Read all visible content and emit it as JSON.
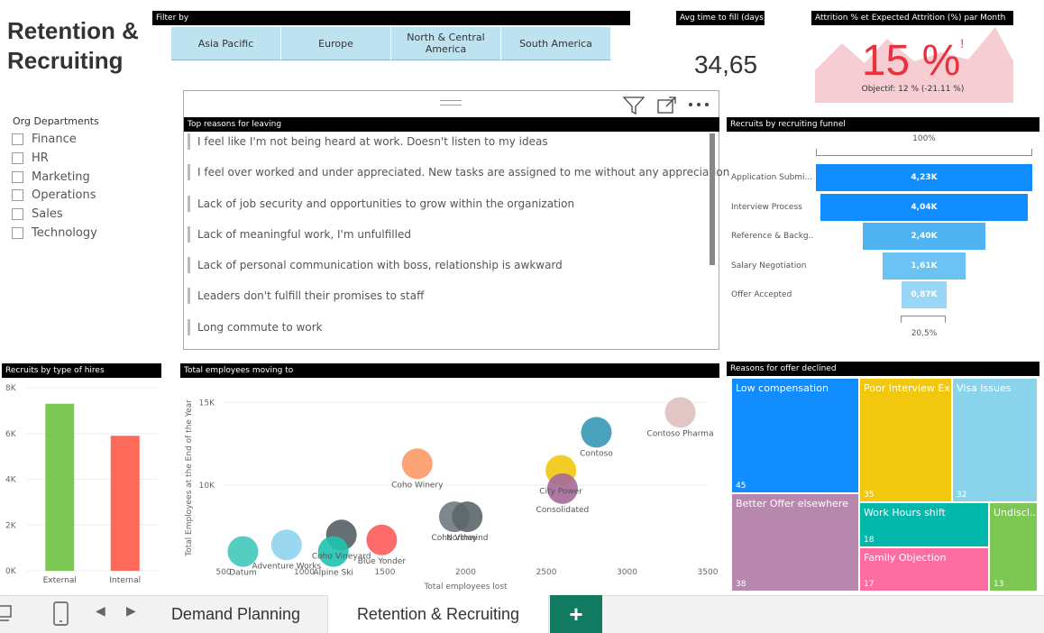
{
  "report": {
    "title": "Retention & Recruiting"
  },
  "filter": {
    "header": "Filter by",
    "options": [
      "Asia Pacific",
      "Europe",
      "North & Central America",
      "South America"
    ]
  },
  "avg_time": {
    "header": "Avg time to fill (days)",
    "value": "34,65"
  },
  "attrition": {
    "header": "Attrition % et Expected Attrition (%) par Month",
    "value": "15 %",
    "marker": "!",
    "target": "Objectif: 12 % (-21.11 %)",
    "colors": {
      "value": "#e8323d",
      "area": "#f6cdd3"
    }
  },
  "org": {
    "title": "Org Departments",
    "items": [
      "Finance",
      "HR",
      "Marketing",
      "Operations",
      "Sales",
      "Technology"
    ]
  },
  "reasons": {
    "header": "Top reasons for leaving",
    "items": [
      "I feel like I'm not being heard at work. Doesn't listen to my ideas",
      "I feel over worked and under appreciated. New tasks are assigned to me without any appreciation",
      "Lack of job security and opportunities to grow within the organization",
      "Lack of meaningful work, I'm unfulfilled",
      "Lack of personal communication with boss, relationship is awkward",
      "Leaders don't fulfill their promises to staff",
      "Long commute to work"
    ]
  },
  "toolbar": {
    "filter_icon": "filter-icon",
    "focus_icon": "focus-mode-icon",
    "more_icon": "more-options-icon"
  },
  "chart_data": [
    {
      "type": "bar",
      "orientation": "horizontal-funnel",
      "title": "Recruits by recruiting funnel",
      "categories": [
        "Application Submi...",
        "Interview Process",
        "Reference & Backg...",
        "Salary Negotiation",
        "Offer Accepted"
      ],
      "values": [
        4230,
        4040,
        2400,
        1610,
        870
      ],
      "value_labels": [
        "4,23K",
        "4,04K",
        "2,40K",
        "1,61K",
        "0,87K"
      ],
      "top_percent": "100%",
      "bottom_percent": "20,5%",
      "colors": [
        "#118dff",
        "#118dff",
        "#4fb3f2",
        "#6cc2f2",
        "#9ad6f5"
      ]
    },
    {
      "type": "bar",
      "title": "Recruits by type of hires",
      "categories": [
        "External",
        "Internal"
      ],
      "values": [
        7300,
        5900
      ],
      "ylim": [
        0,
        8000
      ],
      "yticks": [
        "0K",
        "2K",
        "4K",
        "6K",
        "8K"
      ],
      "colors": [
        "#7dc855",
        "#fd6a5a"
      ]
    },
    {
      "type": "scatter",
      "title": "Total employees moving to",
      "xlabel": "Total employees lost",
      "ylabel": "Total Employees at the End of the Year",
      "xlim": [
        500,
        3500
      ],
      "ylim": [
        5000,
        16000
      ],
      "xticks": [
        "500",
        "1000",
        "1500",
        "2000",
        "2500",
        "3000",
        "3500"
      ],
      "yticks": [
        "10K",
        "15K"
      ],
      "points": [
        {
          "label": "Datum",
          "x": 620,
          "y": 6000,
          "color": "#41c8bd"
        },
        {
          "label": "Adventure Works",
          "x": 890,
          "y": 6400,
          "color": "#8fd3ef"
        },
        {
          "label": "Coho Vineyard",
          "x": 1230,
          "y": 7000,
          "color": "#555f64"
        },
        {
          "label": "Alpine Ski",
          "x": 1180,
          "y": 6000,
          "color": "#1ec2b0"
        },
        {
          "label": "Blue Yonder",
          "x": 1480,
          "y": 6700,
          "color": "#fd5b5b"
        },
        {
          "label": "Coho Winery",
          "x": 1700,
          "y": 11300,
          "color": "#fd9a67"
        },
        {
          "label": "Coho Viney",
          "x": 1930,
          "y": 8100,
          "color": "#6f7a7f"
        },
        {
          "label": "Northwind",
          "x": 2010,
          "y": 8100,
          "color": "#5c676c"
        },
        {
          "label": "City Power",
          "x": 2590,
          "y": 10900,
          "color": "#f2c80f"
        },
        {
          "label": "Consolidated",
          "x": 2600,
          "y": 9800,
          "color": "#a66999"
        },
        {
          "label": "Contoso",
          "x": 2810,
          "y": 13200,
          "color": "#3599b8"
        },
        {
          "label": "Contoso Pharma",
          "x": 3330,
          "y": 14400,
          "color": "#dfbfbf"
        }
      ]
    },
    {
      "type": "treemap",
      "title": "Reasons for offer declined",
      "items": [
        {
          "label": "Low compensation",
          "value": 45,
          "color": "#118dff"
        },
        {
          "label": "Poor Interview Ex...",
          "value": 35,
          "color": "#f2c80f"
        },
        {
          "label": "Visa Issues",
          "value": 32,
          "color": "#8ad4eb"
        },
        {
          "label": "Better Offer elsewhere",
          "value": 38,
          "color": "#b887ad"
        },
        {
          "label": "Work Hours shift",
          "value": 18,
          "color": "#01b8aa"
        },
        {
          "label": "Family Objection",
          "value": 17,
          "color": "#fe6da2"
        },
        {
          "label": "Undiscl...",
          "value": 13,
          "color": "#7dc855"
        }
      ]
    }
  ],
  "tabs": {
    "demand": "Demand Planning",
    "retention": "Retention & Recruiting",
    "add": "+"
  },
  "nav": {
    "desktop_icon": "desktop-icon",
    "phone_icon": "phone-icon",
    "prev": "◀",
    "next": "▶"
  }
}
